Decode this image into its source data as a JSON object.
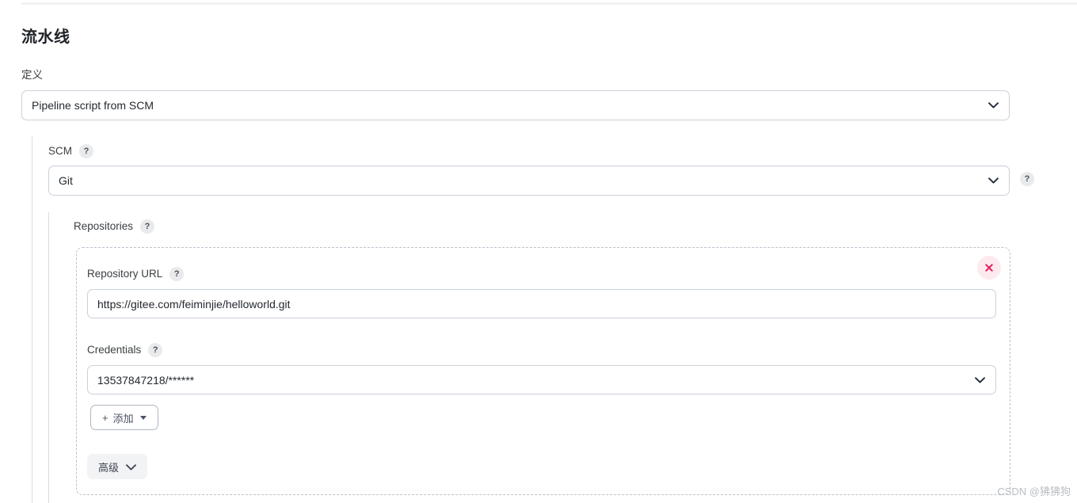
{
  "page": {
    "title": "流水线"
  },
  "definition": {
    "label": "定义",
    "value": "Pipeline script from SCM"
  },
  "scm": {
    "label": "SCM",
    "help": "?",
    "value": "Git",
    "standalone_help": "?"
  },
  "repositories": {
    "label": "Repositories",
    "help": "?",
    "repository_url": {
      "label": "Repository URL",
      "help": "?",
      "value": "https://gitee.com/feiminjie/helloworld.git"
    },
    "credentials": {
      "label": "Credentials",
      "help": "?",
      "value": "13537847218/******"
    },
    "add_button": {
      "plus": "+",
      "label": "添加"
    },
    "advanced_button": {
      "label": "高级"
    },
    "delete_button": {
      "title": "×"
    }
  },
  "watermark": "CSDN @狒狒狗",
  "colors": {
    "accent_danger": "#e01e5a",
    "danger_bg": "#fdeaee",
    "border": "#c9d1d9",
    "dashed_border": "#b9c2cb",
    "text": "#24292f",
    "muted": "#b9bec4"
  }
}
